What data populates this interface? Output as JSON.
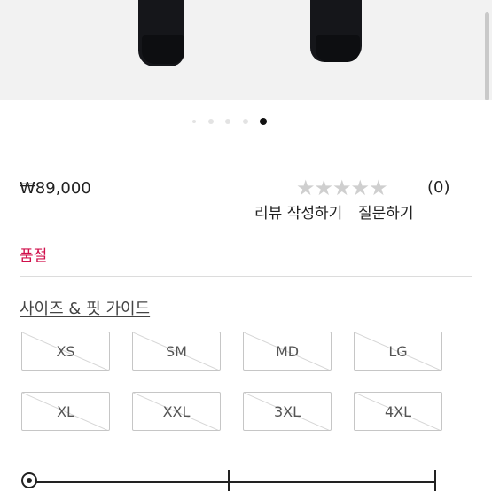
{
  "product": {
    "price": "₩89,000",
    "rating": {
      "stars_glyph": "★★★★★",
      "value": 0,
      "max": 5,
      "count_label": "(0)"
    },
    "review_link": "리뷰 작성하기",
    "qna_link": "질문하기",
    "status": "품절",
    "status_color": "#d0104c"
  },
  "carousel": {
    "total": 5,
    "active_index": 4
  },
  "size_guide_label": "사이즈 & 핏 가이드",
  "sizes": [
    {
      "label": "XS",
      "available": false
    },
    {
      "label": "SM",
      "available": false
    },
    {
      "label": "MD",
      "available": false
    },
    {
      "label": "LG",
      "available": false
    },
    {
      "label": "XL",
      "available": false
    },
    {
      "label": "XXL",
      "available": false
    },
    {
      "label": "3XL",
      "available": false
    },
    {
      "label": "4XL",
      "available": false
    }
  ],
  "fit_slider": {
    "value": 0
  }
}
